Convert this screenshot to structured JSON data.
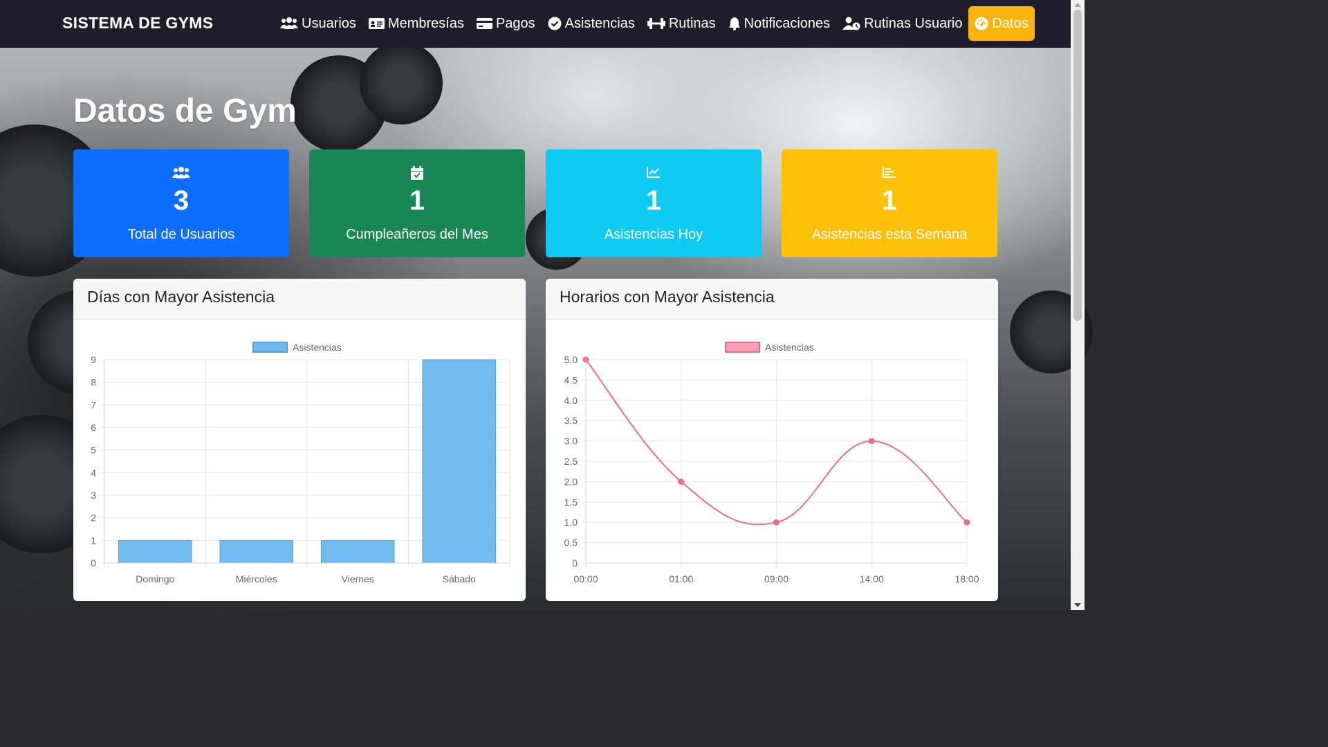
{
  "nav": {
    "brand": "SISTEMA DE GYMS",
    "items": [
      {
        "label": "Usuarios",
        "icon": "users-icon"
      },
      {
        "label": "Membresías",
        "icon": "id-card-icon"
      },
      {
        "label": "Pagos",
        "icon": "credit-card-icon"
      },
      {
        "label": "Asistencias",
        "icon": "check-circle-icon"
      },
      {
        "label": "Rutinas",
        "icon": "dumbbell-icon"
      },
      {
        "label": "Notificaciones",
        "icon": "bell-icon"
      },
      {
        "label": "Rutinas Usuario",
        "icon": "user-clock-icon"
      },
      {
        "label": "Datos",
        "icon": "gauge-icon",
        "active": true
      }
    ],
    "active_color": "#fbb40b",
    "bg_color": "#1f1d2b"
  },
  "page": {
    "title": "Datos de Gym"
  },
  "stats": [
    {
      "value": "3",
      "label": "Total de Usuarios",
      "icon": "users-icon",
      "color": "#0d6efd"
    },
    {
      "value": "1",
      "label": "Cumpleañeros del Mes",
      "icon": "calendar-check-icon",
      "color": "#198754"
    },
    {
      "value": "1",
      "label": "Asistencias Hoy",
      "icon": "chart-line-icon",
      "color": "#0dcaf0"
    },
    {
      "value": "1",
      "label": "Asistencias esta Semana",
      "icon": "chart-bar-icon",
      "color": "#ffc107"
    }
  ],
  "panels": {
    "days_title": "Días con Mayor Asistencia",
    "hours_title": "Horarios con Mayor Asistencia"
  },
  "chart_data": [
    {
      "type": "bar",
      "title": "Días con Mayor Asistencia",
      "categories": [
        "Domingo",
        "Miércoles",
        "Viernes",
        "Sábado"
      ],
      "series": [
        {
          "name": "Asistencias",
          "values": [
            1,
            1,
            1,
            9
          ]
        }
      ],
      "ylim": [
        0,
        9
      ],
      "yticks": [
        "0",
        "1",
        "2",
        "3",
        "4",
        "5",
        "6",
        "7",
        "8",
        "9"
      ],
      "color": "#72bbee",
      "border_color": "#4aa2e0",
      "legend": "top",
      "grid": true
    },
    {
      "type": "line",
      "title": "Horarios con Mayor Asistencia",
      "categories": [
        "00:00",
        "01:00",
        "09:00",
        "14:00",
        "18:00"
      ],
      "series": [
        {
          "name": "Asistencias",
          "values": [
            5,
            2,
            1,
            3,
            1
          ]
        }
      ],
      "ylim": [
        0,
        5
      ],
      "yticks": [
        "0",
        "0.5",
        "1.0",
        "1.5",
        "2.0",
        "2.5",
        "3.0",
        "3.5",
        "4.0",
        "4.5",
        "5.0"
      ],
      "color": "#f06a8a",
      "fill_color": "#f7a0b4",
      "legend": "top",
      "grid": true
    }
  ]
}
